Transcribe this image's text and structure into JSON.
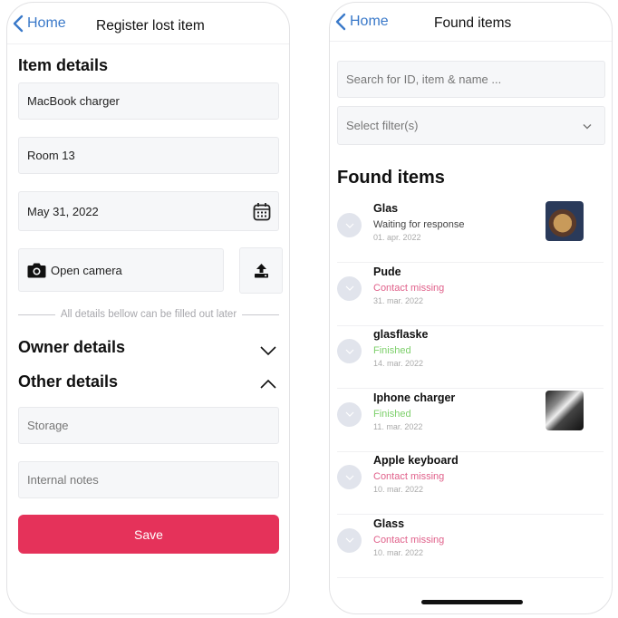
{
  "left_screen": {
    "nav": {
      "back_label": "Home",
      "title": "Register lost item"
    },
    "item_details_title": "Item details",
    "fields": {
      "item_name": "MacBook charger",
      "location": "Room 13",
      "date": "May 31, 2022"
    },
    "camera_button_label": "Open camera",
    "divider_text": "All details bellow can be filled out later",
    "owner_details": {
      "title": "Owner details",
      "expanded": false
    },
    "other_details": {
      "title": "Other details",
      "expanded": true
    },
    "storage_placeholder": "Storage",
    "internal_notes_placeholder": "Internal notes",
    "save_label": "Save",
    "colors": {
      "accent": "#e5325a",
      "link": "#3a79c9"
    }
  },
  "right_screen": {
    "nav": {
      "back_label": "Home",
      "title": "Found items"
    },
    "search_placeholder": "Search for ID, item & name ...",
    "filter_placeholder": "Select filter(s)",
    "list_title": "Found items",
    "items": [
      {
        "name": "Glas",
        "status": "Waiting for response",
        "status_type": "waiting",
        "date": "01. apr. 2022",
        "has_photo": true
      },
      {
        "name": "Pude",
        "status": "Contact missing",
        "status_type": "missing",
        "date": "31. mar. 2022",
        "has_photo": false
      },
      {
        "name": "glasflaske",
        "status": "Finished",
        "status_type": "finished",
        "date": "14. mar. 2022",
        "has_photo": false
      },
      {
        "name": "Iphone charger",
        "status": "Finished",
        "status_type": "finished",
        "date": "11. mar. 2022",
        "has_photo": true
      },
      {
        "name": "Apple keyboard",
        "status": "Contact missing",
        "status_type": "missing",
        "date": "10. mar. 2022",
        "has_photo": false
      },
      {
        "name": "Glass",
        "status": "Contact missing",
        "status_type": "missing",
        "date": "10. mar. 2022",
        "has_photo": false
      }
    ],
    "status_colors": {
      "waiting": "#444444",
      "missing": "#e0608a",
      "finished": "#7ccf6a"
    }
  }
}
